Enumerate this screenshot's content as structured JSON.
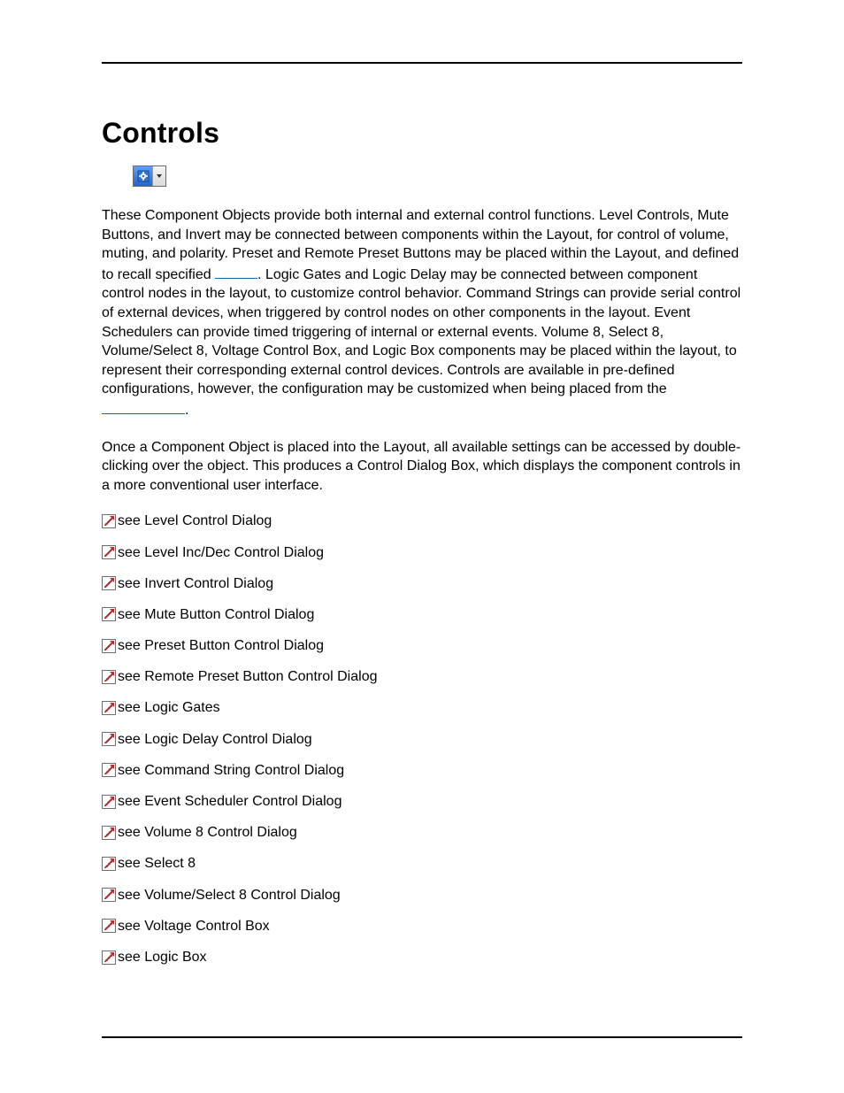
{
  "heading": "Controls",
  "toolbar": {
    "icon_name": "controls-toolbar-icon"
  },
  "para1": {
    "a": "These Component Objects provide both internal and external control functions. Level Controls, Mute Buttons, and Invert may be connected between components within the Layout, for control of volume, muting, and polarity. Preset and Remote Preset Buttons may be placed within the Layout, and defined to recall specified ",
    "link1_width": 48,
    "b": ". Logic Gates and Logic Delay may be connected between component control nodes in the layout, to customize control behavior. Command Strings can provide serial control of external devices, when triggered by control nodes on other components in the layout. Event Schedulers can provide timed triggering of internal or external events. Volume 8, Select 8, Volume/Select 8, Voltage Control Box, and Logic Box components may be placed within the layout, to represent their corresponding external control devices. Controls are available in pre-defined configurations, however, the configuration may be customized when being placed from the ",
    "link2_width": 94,
    "c": "."
  },
  "para2": "Once a Component Object is placed into the Layout, all available settings can be accessed by double-clicking over the object. This produces a Control Dialog Box, which displays the component controls in a more conventional user interface.",
  "links": [
    "see Level Control Dialog",
    "see Level Inc/Dec Control Dialog",
    "see Invert Control Dialog",
    "see Mute Button Control Dialog",
    "see Preset Button Control Dialog",
    "see Remote Preset Button Control Dialog",
    "see Logic Gates",
    "see Logic Delay Control Dialog",
    "see Command String Control Dialog",
    "see Event Scheduler Control Dialog",
    "see Volume 8 Control Dialog",
    "see Select 8",
    "see Volume/Select 8 Control Dialog",
    "see Voltage Control Box",
    "see Logic Box"
  ]
}
